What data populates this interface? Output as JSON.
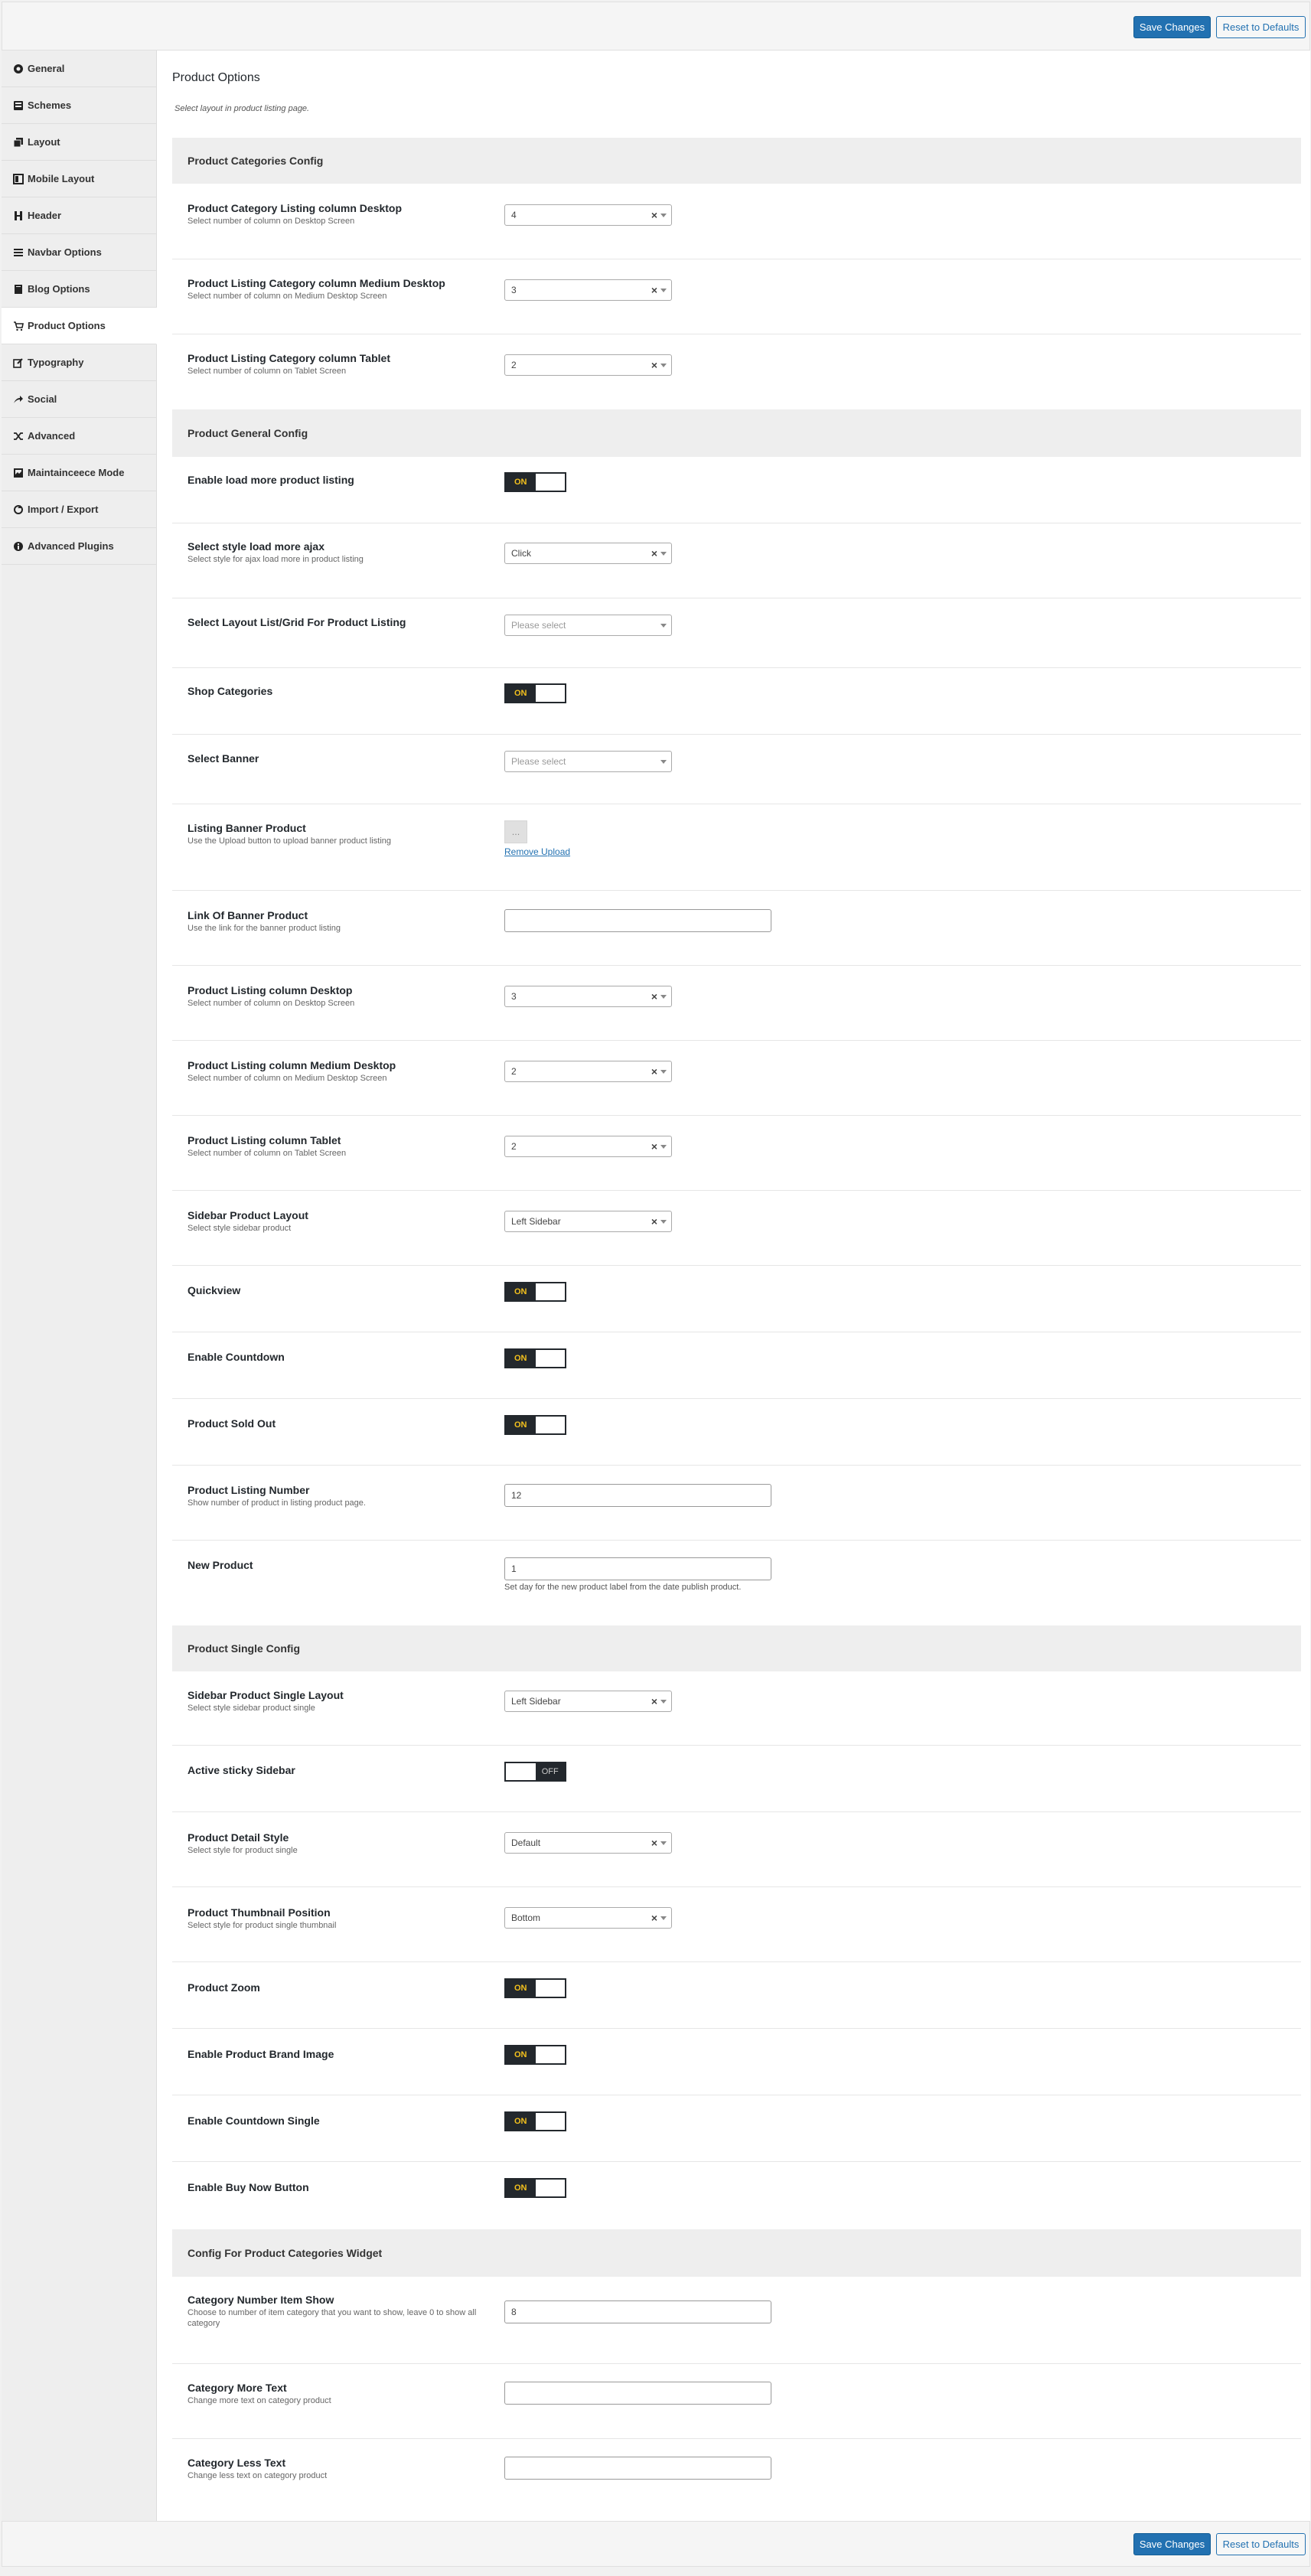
{
  "toolbar": {
    "save_label": "Save Changes",
    "reset_label": "Reset to Defaults"
  },
  "sidebar": {
    "items": [
      {
        "label": "General",
        "icon": "circle-icon"
      },
      {
        "label": "Schemes",
        "icon": "palette-icon"
      },
      {
        "label": "Layout",
        "icon": "copy-icon"
      },
      {
        "label": "Mobile Layout",
        "icon": "layout-icon"
      },
      {
        "label": "Header",
        "icon": "header-icon"
      },
      {
        "label": "Navbar Options",
        "icon": "menu-icon"
      },
      {
        "label": "Blog Options",
        "icon": "book-icon"
      },
      {
        "label": "Product Options",
        "icon": "cart-icon",
        "active": true
      },
      {
        "label": "Typography",
        "icon": "edit-icon"
      },
      {
        "label": "Social",
        "icon": "share-icon"
      },
      {
        "label": "Advanced",
        "icon": "shuffle-icon"
      },
      {
        "label": "Maintainceece Mode",
        "icon": "image-icon"
      },
      {
        "label": "Import / Export",
        "icon": "refresh-icon"
      },
      {
        "label": "Advanced Plugins",
        "icon": "info-icon"
      }
    ]
  },
  "main": {
    "title": "Product Options",
    "description": "Select layout in product listing page.",
    "sections": [
      {
        "title": "Product Categories Config"
      },
      {
        "title": "Product General Config"
      },
      {
        "title": "Product Single Config"
      },
      {
        "title": "Config For Product Categories Widget"
      }
    ],
    "fields": {
      "cat_desktop": {
        "title": "Product Category Listing column Desktop",
        "sub": "Select number of column on Desktop Screen",
        "value": "4"
      },
      "cat_medium": {
        "title": "Product Listing Category column Medium Desktop",
        "sub": "Select number of column on Medium Desktop Screen",
        "value": "3"
      },
      "cat_tablet": {
        "title": "Product Listing Category column Tablet",
        "sub": "Select number of column on Tablet Screen",
        "value": "2"
      },
      "load_more": {
        "title": "Enable load more product listing",
        "state": "ON"
      },
      "load_style": {
        "title": "Select style load more ajax",
        "sub": "Select style for ajax load more in product listing",
        "value": "Click"
      },
      "layout_list": {
        "title": "Select Layout List/Grid For Product Listing",
        "placeholder": "Please select"
      },
      "shop_categories": {
        "title": "Shop Categories",
        "state": "ON"
      },
      "banner": {
        "title": "Select Banner",
        "placeholder": "Please select"
      },
      "listing_banner": {
        "title": "Listing Banner Product",
        "sub": "Use the Upload button to upload banner product listing",
        "thumb": "...",
        "remove_label": "Remove Upload"
      },
      "banner_link": {
        "title": "Link Of Banner Product",
        "sub": "Use the link for the banner product listing",
        "value": ""
      },
      "list_desktop": {
        "title": "Product Listing column Desktop",
        "sub": "Select number of column on Desktop Screen",
        "value": "3"
      },
      "list_medium": {
        "title": "Product Listing column Medium Desktop",
        "sub": "Select number of column on Medium Desktop Screen",
        "value": "2"
      },
      "list_tablet": {
        "title": "Product Listing column Tablet",
        "sub": "Select number of column on Tablet Screen",
        "value": "2"
      },
      "sidebar_layout": {
        "title": "Sidebar Product Layout",
        "sub": "Select style sidebar product",
        "value": "Left Sidebar"
      },
      "quickview": {
        "title": "Quickview",
        "state": "ON"
      },
      "countdown": {
        "title": "Enable Countdown",
        "state": "ON"
      },
      "sold_out": {
        "title": "Product Sold Out",
        "state": "ON"
      },
      "listing_number": {
        "title": "Product Listing Number",
        "sub": "Show number of product in listing product page.",
        "value": "12"
      },
      "new_product": {
        "title": "New Product",
        "value": "1",
        "hint": "Set day for the new product label from the date publish product."
      },
      "single_layout": {
        "title": "Sidebar Product Single Layout",
        "sub": "Select style sidebar product single",
        "value": "Left Sidebar"
      },
      "sticky_sidebar": {
        "title": "Active sticky Sidebar",
        "state": "OFF"
      },
      "detail_style": {
        "title": "Product Detail Style",
        "sub": "Select style for product single",
        "value": "Default"
      },
      "thumb_position": {
        "title": "Product Thumbnail Position",
        "sub": "Select style for product single thumbnail",
        "value": "Bottom"
      },
      "zoom": {
        "title": "Product Zoom",
        "state": "ON"
      },
      "brand_image": {
        "title": "Enable Product Brand Image",
        "state": "ON"
      },
      "countdown_single": {
        "title": "Enable Countdown Single",
        "state": "ON"
      },
      "buy_now": {
        "title": "Enable Buy Now Button",
        "state": "ON"
      },
      "cat_item_show": {
        "title": "Category Number Item Show",
        "sub": "Choose to number of item category that you want to show, leave 0 to show all category",
        "value": "8"
      },
      "cat_more": {
        "title": "Category More Text",
        "sub": "Change more text on category product",
        "value": ""
      },
      "cat_less": {
        "title": "Category Less Text",
        "sub": "Change less text on category product",
        "value": ""
      }
    }
  },
  "colors": {
    "primary": "#2271b1",
    "toggle_dark": "#23282d",
    "toggle_on_text": "#f2c01d"
  }
}
